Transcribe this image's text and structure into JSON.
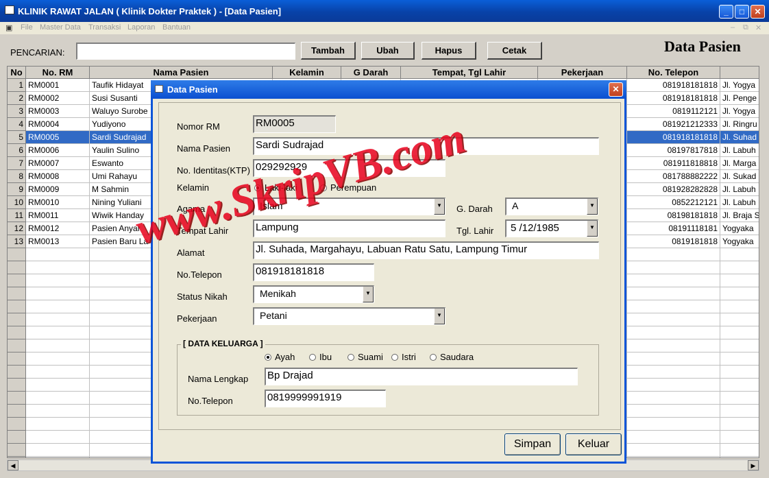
{
  "window": {
    "title": "KLINIK RAWAT JALAN ( Klinik Dokter Praktek ) - [Data Pasien]"
  },
  "menu": [
    "File",
    "Master Data",
    "Transaksi",
    "Laporan",
    "Bantuan"
  ],
  "toolbar": {
    "search_label": "PENCARIAN:",
    "search_value": "",
    "tambah": "Tambah",
    "ubah": "Ubah",
    "hapus": "Hapus",
    "cetak": "Cetak",
    "page_title": "Data Pasien"
  },
  "grid": {
    "columns": [
      "No",
      "No. RM",
      "Nama Pasien",
      "Kelamin",
      "G Darah",
      "Tempat, Tgl Lahir",
      "Pekerjaan",
      "No. Telepon",
      ""
    ],
    "selected_row": 5,
    "rows": [
      {
        "no": "1",
        "rm": "RM0001",
        "nama": "Taufik Hidayat",
        "telp": "081918181818",
        "alamat": "Jl. Yogya"
      },
      {
        "no": "2",
        "rm": "RM0002",
        "nama": "Susi Susanti",
        "telp": "081918181818",
        "alamat": "Jl. Penge"
      },
      {
        "no": "3",
        "rm": "RM0003",
        "nama": "Waluyo Surobe",
        "telp": "0819112121",
        "alamat": "Jl. Yogya"
      },
      {
        "no": "4",
        "rm": "RM0004",
        "nama": "Yudiyono",
        "telp": "081921212333",
        "alamat": "Jl. Ringru"
      },
      {
        "no": "5",
        "rm": "RM0005",
        "nama": "Sardi Sudrajad",
        "telp": "081918181818",
        "alamat": "Jl. Suhad"
      },
      {
        "no": "6",
        "rm": "RM0006",
        "nama": "Yaulin Sulino",
        "telp": "08197817818",
        "alamat": "Jl. Labuh"
      },
      {
        "no": "7",
        "rm": "RM0007",
        "nama": "Eswanto",
        "telp": "081911818818",
        "alamat": "Jl. Marga"
      },
      {
        "no": "8",
        "rm": "RM0008",
        "nama": "Umi Rahayu",
        "telp": "081788882222",
        "alamat": "Jl. Sukad"
      },
      {
        "no": "9",
        "rm": "RM0009",
        "nama": "M Sahmin",
        "telp": "081928282828",
        "alamat": "Jl. Labuh"
      },
      {
        "no": "10",
        "rm": "RM0010",
        "nama": "Nining Yuliani",
        "telp": "0852212121",
        "alamat": "Jl. Labuh"
      },
      {
        "no": "11",
        "rm": "RM0011",
        "nama": "Wiwik Handay",
        "telp": "08198181818",
        "alamat": "Jl. Braja S"
      },
      {
        "no": "12",
        "rm": "RM0012",
        "nama": "Pasien Anyar",
        "telp": "08191118181",
        "alamat": "Yogyaka"
      },
      {
        "no": "13",
        "rm": "RM0013",
        "nama": "Pasien Baru La",
        "telp": "0819181818",
        "alamat": "Yogyaka"
      }
    ]
  },
  "dialog": {
    "title": "Data Pasien",
    "labels": {
      "nomor_rm": "Nomor RM",
      "nama": "Nama Pasien",
      "ktp": "No. Identitas(KTP)",
      "kelamin": "Kelamin",
      "agama": "Agama",
      "gdarah": "G. Darah",
      "tempat": "Tempat Lahir",
      "tgl": "Tgl. Lahir",
      "alamat": "Alamat",
      "telp": "No.Telepon",
      "status": "Status Nikah",
      "pekerjaan": "Pekerjaan"
    },
    "values": {
      "nomor_rm": "RM0005",
      "nama": "Sardi Sudrajad",
      "ktp": "029292929",
      "agama": "Islam",
      "gdarah": "A",
      "tempat": "Lampung",
      "tgl": "5 /12/1985",
      "alamat": "Jl. Suhada, Margahayu, Labuan Ratu Satu, Lampung Timur",
      "telp": "081918181818",
      "status": "Menikah",
      "pekerjaan": "Petani"
    },
    "kelamin_options": [
      "Laki-laki",
      "Perempuan"
    ],
    "kelamin_selected": "Laki-laki",
    "keluarga": {
      "group_label": "[ DATA KELUARGA ]",
      "relations": [
        "Ayah",
        "Ibu",
        "Suami",
        "Istri",
        "Saudara"
      ],
      "relation_selected": "Ayah",
      "nama_label": "Nama Lengkap",
      "nama_value": "Bp Drajad",
      "telp_label": "No.Telepon",
      "telp_value": "0819999991919"
    },
    "simpan": "Simpan",
    "keluar": "Keluar"
  },
  "watermark": "www.SkripVB.com",
  "colors": {
    "titlebar": "#0842a8",
    "selection": "#316ac5",
    "watermark": "#e8001c"
  }
}
